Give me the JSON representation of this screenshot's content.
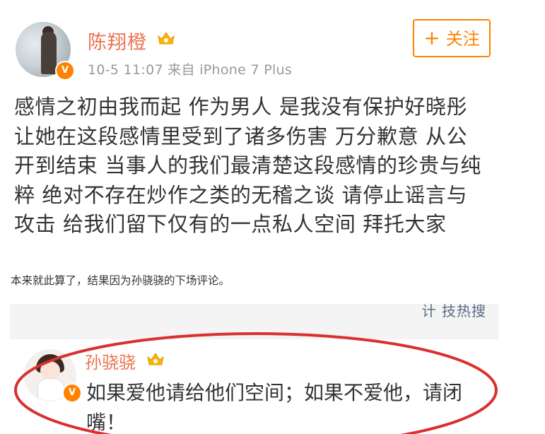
{
  "post": {
    "author": "陈翔橙",
    "meta": "10-5 11:07  来自 iPhone 7 Plus",
    "follow_label": "关注",
    "follow_icon": "plus-icon",
    "verified_badge": "V",
    "lines": [
      "感情之初由我而起 作为男人 是我没有保护好晓彤",
      "让她在这段感情里受到了诸多伤害 万分歉意 从公",
      "开到结束 当事人的我们最清楚这段感情的珍贵与纯",
      "粹 绝对不存在炒作之类的无稽之谈 请停止谣言与",
      "攻击 给我们留下仅有的一点私人空间 拜托大家"
    ]
  },
  "caption": "本来就此算了，结果因为孙骁骁的下场评论。",
  "reply": {
    "top_cut_text": "计 技热搜",
    "author": "孙骁骁",
    "verified_badge": "V",
    "comment": "如果爱他请给他们空间；如果不爱他，请闭嘴！"
  },
  "colors": {
    "accent": "#ff8200",
    "username": "#eb7350",
    "highlight_circle": "#d93030"
  }
}
